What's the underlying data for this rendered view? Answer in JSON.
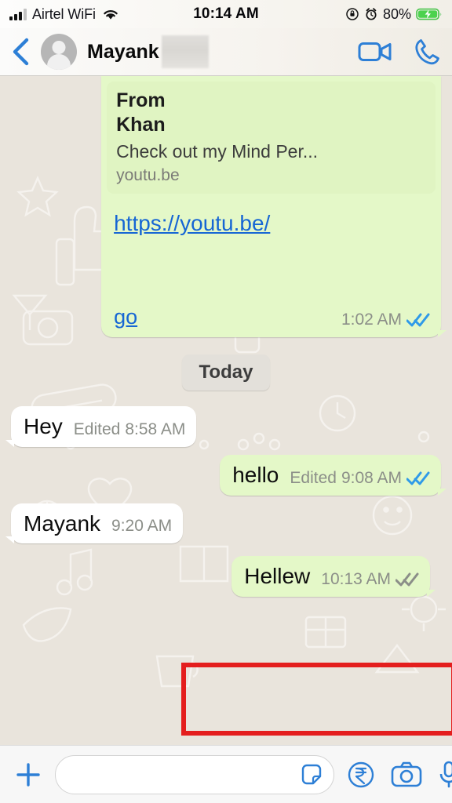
{
  "status_bar": {
    "carrier": "Airtel WiFi",
    "time": "10:14 AM",
    "battery_percent": "80%",
    "icons": [
      "signal-bars-icon",
      "wifi-icon",
      "rotation-lock-icon",
      "alarm-clock-icon",
      "battery-charging-icon"
    ]
  },
  "header": {
    "back_label": "back-chevron-icon",
    "contact_name": "Mayank",
    "redacted_label": "",
    "video_call_label": "video-call-icon",
    "voice_call_label": "voice-call-icon"
  },
  "chat": {
    "date_divider": "Today",
    "messages": [
      {
        "id": "link-preview-message",
        "direction": "out",
        "clipped": true,
        "preview": {
          "title_line1": "From",
          "title_line2": "Khan",
          "description": "Check out my Mind Per...",
          "domain": "youtu.be"
        },
        "link_text": "https://youtu.be/",
        "secondary_link_text": "go",
        "time": "1:02 AM",
        "receipt": "read"
      },
      {
        "id": "hey-message",
        "direction": "in",
        "text": "Hey",
        "edited_label": "Edited",
        "time": "8:58 AM",
        "receipt": "none"
      },
      {
        "id": "hello-message",
        "direction": "out",
        "text": "hello",
        "edited_label": "Edited",
        "time": "9:08 AM",
        "receipt": "read"
      },
      {
        "id": "mayank-message",
        "direction": "in",
        "text": "Mayank",
        "time": "9:20 AM",
        "receipt": "none"
      },
      {
        "id": "hellew-message",
        "direction": "out",
        "text": "Hellew",
        "time": "10:13 AM",
        "receipt": "delivered",
        "highlighted": true
      }
    ]
  },
  "input_bar": {
    "attach_label": "plus-icon",
    "message_placeholder": "",
    "message_value": "",
    "sticker_label": "sticker-icon",
    "payments_label": "rupee-payment-icon",
    "camera_label": "camera-icon",
    "mic_label": "microphone-icon"
  },
  "annotation": {
    "color": "#e41e1e",
    "target": "hellew-message"
  },
  "colors": {
    "outgoing_bubble": "#e4f8c8",
    "incoming_bubble": "#ffffff",
    "chat_background": "#e9e4dc",
    "accent_blue": "#2d7fd6",
    "link_blue": "#1666d4",
    "read_receipt_blue": "#2f9ae8",
    "delivered_receipt_gray": "#8b8e88"
  }
}
